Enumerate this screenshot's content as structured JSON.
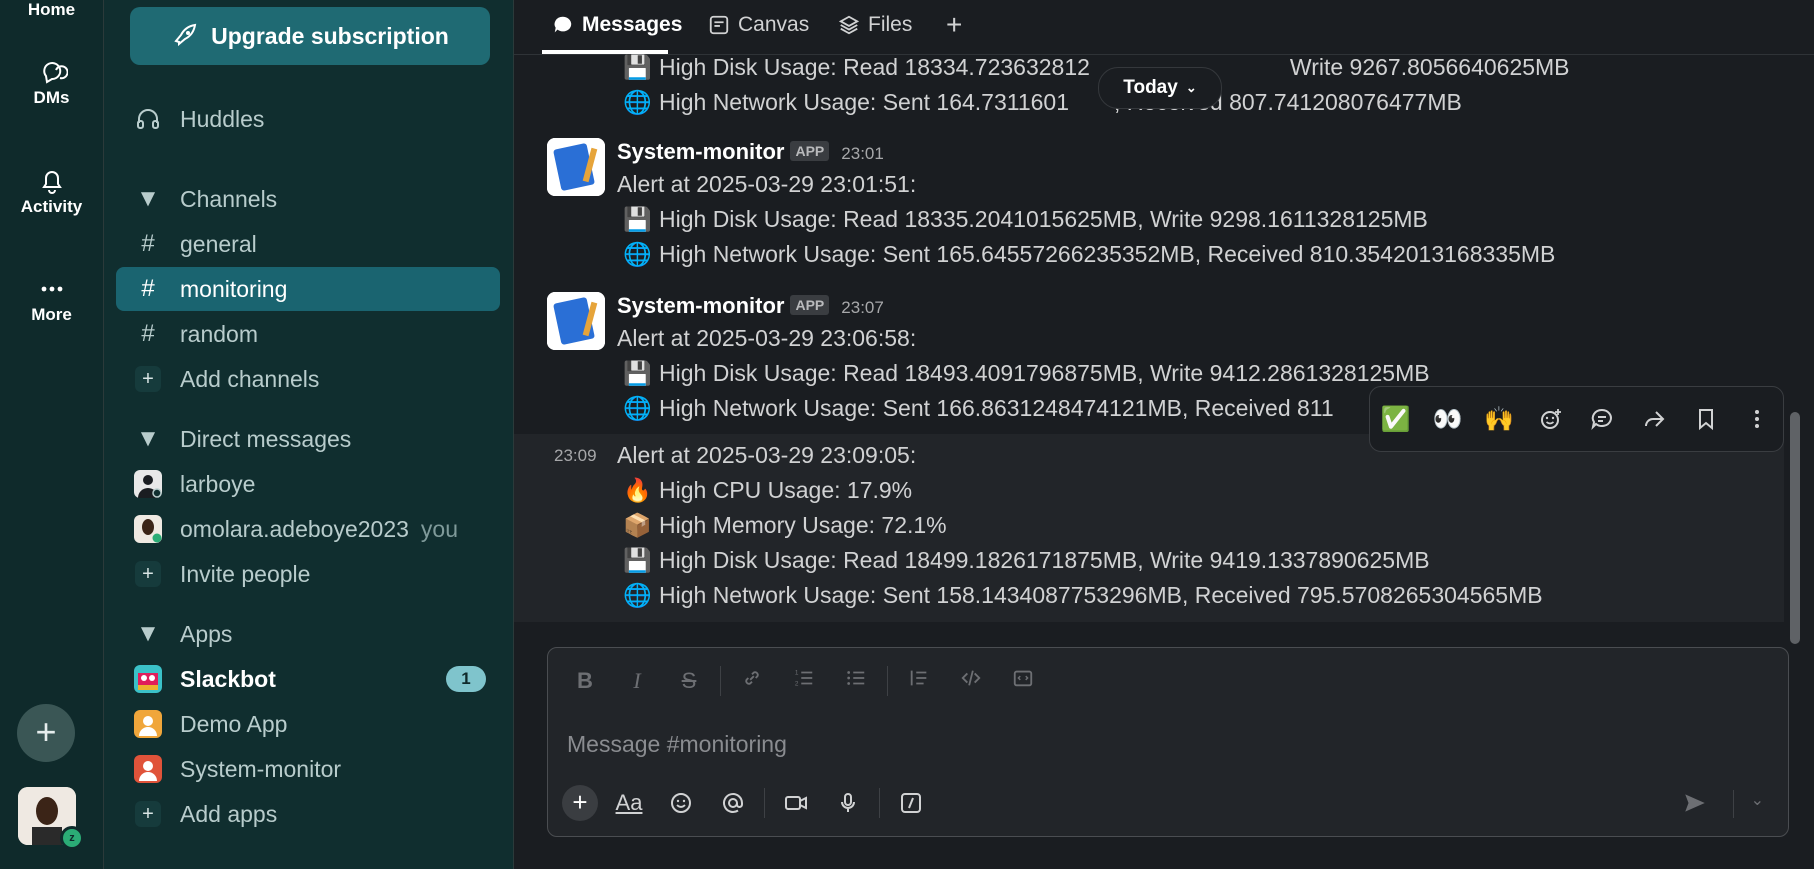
{
  "rail": {
    "home_label": "Home",
    "dms_label": "DMs",
    "activity_label": "Activity",
    "more_label": "More",
    "add_symbol": "+"
  },
  "sidebar": {
    "upgrade_label": "Upgrade subscription",
    "huddles_label": "Huddles",
    "channels_header": "Channels",
    "channels": [
      {
        "name": "general"
      },
      {
        "name": "monitoring"
      },
      {
        "name": "random"
      }
    ],
    "add_channels": "Add channels",
    "dm_header": "Direct messages",
    "dms": [
      {
        "name": "larboye"
      },
      {
        "name": "omolara.adeboye2023",
        "suffix": "you"
      }
    ],
    "invite_people": "Invite people",
    "apps_header": "Apps",
    "apps": [
      {
        "name": "Slackbot",
        "badge": "1"
      },
      {
        "name": "Demo App"
      },
      {
        "name": "System-monitor"
      }
    ],
    "add_apps": "Add apps"
  },
  "tabs": {
    "messages": "Messages",
    "canvas": "Canvas",
    "files": "Files",
    "add": "+"
  },
  "today_pill": "Today",
  "messages": {
    "partial": {
      "line1": "High Disk Usage: Read 18334.723632812500MB, Write 9267.8056640625MB",
      "line2": "High Network Usage: Sent 164.73116016... Received 807.741208076477MB",
      "line1_shown": "High Disk Usage: Read 18334.723632812",
      "line1_tail": "Write 9267.8056640625MB",
      "line2_shown": "High Network Usage: Sent 164.7311601",
      "line2_tail": ", Received 807.741208076477MB"
    },
    "m1": {
      "sender": "System-monitor",
      "tag": "APP",
      "time": "23:01",
      "text": "Alert at 2025-03-29 23:01:51:",
      "disk": "High Disk Usage: Read 18335.2041015625MB, Write 9298.1611328125MB",
      "net": "High Network Usage: Sent 165.64557266235352MB, Received 810.3542013168335MB"
    },
    "m2": {
      "sender": "System-monitor",
      "tag": "APP",
      "time": "23:07",
      "text": "Alert at 2025-03-29 23:06:58:",
      "disk": "High Disk Usage: Read 18493.4091796875MB, Write 9412.2861328125MB",
      "net": "High Network Usage: Sent 166.8631248474121MB, Received 811"
    },
    "m3": {
      "time": "23:09",
      "text": "Alert at 2025-03-29 23:09:05:",
      "cpu": "High CPU Usage: 17.9%",
      "mem": "High Memory Usage: 72.1%",
      "disk": "High Disk Usage: Read 18499.1826171875MB, Write 9419.1337890625MB",
      "net": "High Network Usage: Sent 158.1434087753296MB, Received 795.5708265304565MB"
    }
  },
  "emoji": {
    "disk": "💾",
    "net": "🌐",
    "cpu": "🔥",
    "mem": "📦"
  },
  "toolbar": {
    "check": "✅",
    "eyes": "👀",
    "raised_hands": "🙌"
  },
  "composer": {
    "placeholder": "Message #monitoring",
    "aa": "Aa"
  }
}
